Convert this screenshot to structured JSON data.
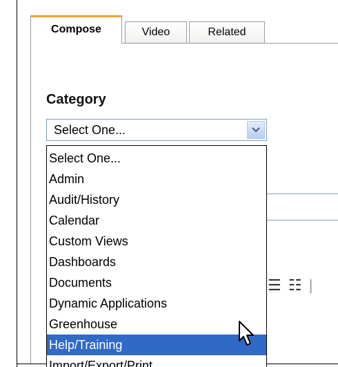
{
  "tabs": [
    {
      "label": "Compose",
      "active": true
    },
    {
      "label": "Video",
      "active": false
    },
    {
      "label": "Related",
      "active": false
    }
  ],
  "category": {
    "label": "Category",
    "selected_value": "Select One...",
    "options": [
      "Select One...",
      "Admin",
      "Audit/History",
      "Calendar",
      "Custom Views",
      "Dashboards",
      "Documents",
      "Dynamic Applications",
      "Greenhouse",
      "Help/Training",
      "Import/Export/Print"
    ],
    "highlighted_option": "Help/Training"
  },
  "toolbar": {
    "icons": [
      "bullet-list-icon",
      "numbered-list-icon"
    ]
  },
  "colors": {
    "active_tab_accent": "#f0a030",
    "highlight": "#3169c6"
  }
}
